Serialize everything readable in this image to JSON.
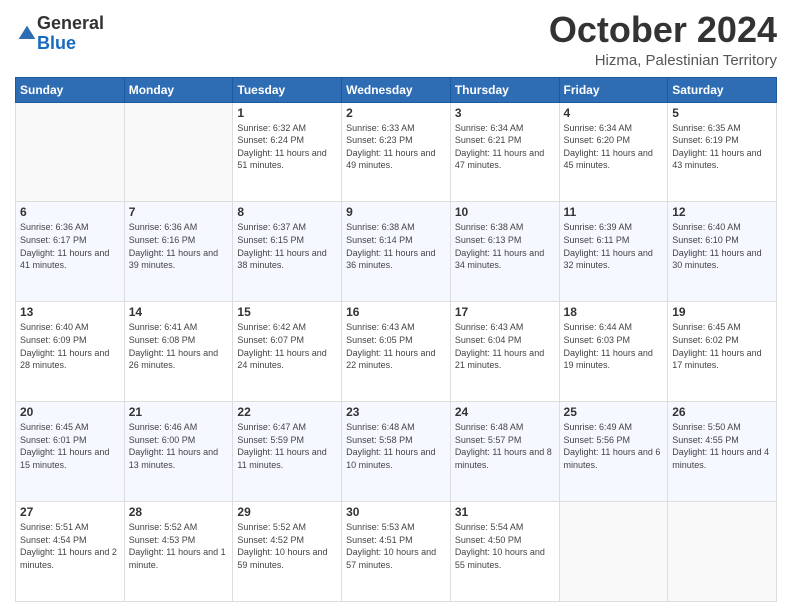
{
  "logo": {
    "general": "General",
    "blue": "Blue"
  },
  "header": {
    "month": "October 2024",
    "location": "Hizma, Palestinian Territory"
  },
  "days_of_week": [
    "Sunday",
    "Monday",
    "Tuesday",
    "Wednesday",
    "Thursday",
    "Friday",
    "Saturday"
  ],
  "weeks": [
    [
      {
        "day": "",
        "info": ""
      },
      {
        "day": "",
        "info": ""
      },
      {
        "day": "1",
        "info": "Sunrise: 6:32 AM\nSunset: 6:24 PM\nDaylight: 11 hours and 51 minutes."
      },
      {
        "day": "2",
        "info": "Sunrise: 6:33 AM\nSunset: 6:23 PM\nDaylight: 11 hours and 49 minutes."
      },
      {
        "day": "3",
        "info": "Sunrise: 6:34 AM\nSunset: 6:21 PM\nDaylight: 11 hours and 47 minutes."
      },
      {
        "day": "4",
        "info": "Sunrise: 6:34 AM\nSunset: 6:20 PM\nDaylight: 11 hours and 45 minutes."
      },
      {
        "day": "5",
        "info": "Sunrise: 6:35 AM\nSunset: 6:19 PM\nDaylight: 11 hours and 43 minutes."
      }
    ],
    [
      {
        "day": "6",
        "info": "Sunrise: 6:36 AM\nSunset: 6:17 PM\nDaylight: 11 hours and 41 minutes."
      },
      {
        "day": "7",
        "info": "Sunrise: 6:36 AM\nSunset: 6:16 PM\nDaylight: 11 hours and 39 minutes."
      },
      {
        "day": "8",
        "info": "Sunrise: 6:37 AM\nSunset: 6:15 PM\nDaylight: 11 hours and 38 minutes."
      },
      {
        "day": "9",
        "info": "Sunrise: 6:38 AM\nSunset: 6:14 PM\nDaylight: 11 hours and 36 minutes."
      },
      {
        "day": "10",
        "info": "Sunrise: 6:38 AM\nSunset: 6:13 PM\nDaylight: 11 hours and 34 minutes."
      },
      {
        "day": "11",
        "info": "Sunrise: 6:39 AM\nSunset: 6:11 PM\nDaylight: 11 hours and 32 minutes."
      },
      {
        "day": "12",
        "info": "Sunrise: 6:40 AM\nSunset: 6:10 PM\nDaylight: 11 hours and 30 minutes."
      }
    ],
    [
      {
        "day": "13",
        "info": "Sunrise: 6:40 AM\nSunset: 6:09 PM\nDaylight: 11 hours and 28 minutes."
      },
      {
        "day": "14",
        "info": "Sunrise: 6:41 AM\nSunset: 6:08 PM\nDaylight: 11 hours and 26 minutes."
      },
      {
        "day": "15",
        "info": "Sunrise: 6:42 AM\nSunset: 6:07 PM\nDaylight: 11 hours and 24 minutes."
      },
      {
        "day": "16",
        "info": "Sunrise: 6:43 AM\nSunset: 6:05 PM\nDaylight: 11 hours and 22 minutes."
      },
      {
        "day": "17",
        "info": "Sunrise: 6:43 AM\nSunset: 6:04 PM\nDaylight: 11 hours and 21 minutes."
      },
      {
        "day": "18",
        "info": "Sunrise: 6:44 AM\nSunset: 6:03 PM\nDaylight: 11 hours and 19 minutes."
      },
      {
        "day": "19",
        "info": "Sunrise: 6:45 AM\nSunset: 6:02 PM\nDaylight: 11 hours and 17 minutes."
      }
    ],
    [
      {
        "day": "20",
        "info": "Sunrise: 6:45 AM\nSunset: 6:01 PM\nDaylight: 11 hours and 15 minutes."
      },
      {
        "day": "21",
        "info": "Sunrise: 6:46 AM\nSunset: 6:00 PM\nDaylight: 11 hours and 13 minutes."
      },
      {
        "day": "22",
        "info": "Sunrise: 6:47 AM\nSunset: 5:59 PM\nDaylight: 11 hours and 11 minutes."
      },
      {
        "day": "23",
        "info": "Sunrise: 6:48 AM\nSunset: 5:58 PM\nDaylight: 11 hours and 10 minutes."
      },
      {
        "day": "24",
        "info": "Sunrise: 6:48 AM\nSunset: 5:57 PM\nDaylight: 11 hours and 8 minutes."
      },
      {
        "day": "25",
        "info": "Sunrise: 6:49 AM\nSunset: 5:56 PM\nDaylight: 11 hours and 6 minutes."
      },
      {
        "day": "26",
        "info": "Sunrise: 5:50 AM\nSunset: 4:55 PM\nDaylight: 11 hours and 4 minutes."
      }
    ],
    [
      {
        "day": "27",
        "info": "Sunrise: 5:51 AM\nSunset: 4:54 PM\nDaylight: 11 hours and 2 minutes."
      },
      {
        "day": "28",
        "info": "Sunrise: 5:52 AM\nSunset: 4:53 PM\nDaylight: 11 hours and 1 minute."
      },
      {
        "day": "29",
        "info": "Sunrise: 5:52 AM\nSunset: 4:52 PM\nDaylight: 10 hours and 59 minutes."
      },
      {
        "day": "30",
        "info": "Sunrise: 5:53 AM\nSunset: 4:51 PM\nDaylight: 10 hours and 57 minutes."
      },
      {
        "day": "31",
        "info": "Sunrise: 5:54 AM\nSunset: 4:50 PM\nDaylight: 10 hours and 55 minutes."
      },
      {
        "day": "",
        "info": ""
      },
      {
        "day": "",
        "info": ""
      }
    ]
  ]
}
